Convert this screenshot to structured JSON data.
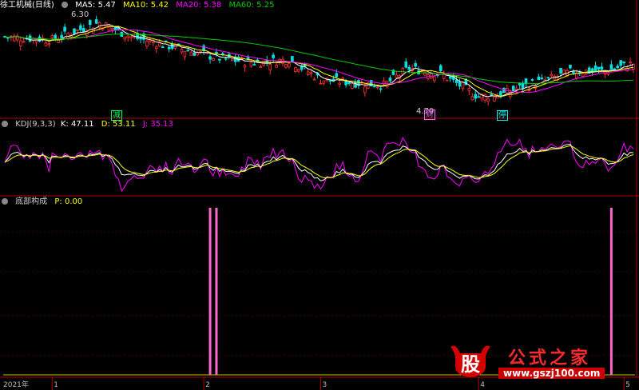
{
  "main_header": {
    "title": "徐工机械(日线)",
    "ma5_label": "MA5: 5.47",
    "ma10_label": "MA10: 5.42",
    "ma20_label": "MA20: 5.38",
    "ma60_label": "MA60: 5.25"
  },
  "kdj_header": {
    "name": "KDJ(9,3,3)",
    "k_label": "K: 47.11",
    "d_label": "D: 53.11",
    "j_label": "J: 35.13"
  },
  "bottom_header": {
    "name": "底部构成",
    "p_label": "P: 0.00"
  },
  "annotations": {
    "high_price": "6.30",
    "low_price": "4.70",
    "mark_jian": "减",
    "mark_cai": "财",
    "mark_ting": "停"
  },
  "time_axis": [
    "2021年",
    "1",
    "2",
    "3",
    "4",
    "5"
  ],
  "colors": {
    "up": "#ff3030",
    "down": "#00e0e0",
    "ma5": "#ffffff",
    "ma10": "#ffff00",
    "ma20": "#ff00ff",
    "ma60": "#00cc00",
    "k": "#ffffff",
    "d": "#ffff00",
    "j": "#ff00ff",
    "signal": "#ff66cc",
    "divider": "#b00000"
  },
  "watermark": {
    "logo_char": "股",
    "title": "公式之家",
    "url": "www.gszj100.com"
  },
  "chart_data": [
    {
      "type": "candlestick",
      "title": "徐工机械(日线)",
      "series": [
        {
          "name": "MA5",
          "last": 5.47
        },
        {
          "name": "MA10",
          "last": 5.42
        },
        {
          "name": "MA20",
          "last": 5.38
        },
        {
          "name": "MA60",
          "last": 5.25
        }
      ],
      "annotations": [
        {
          "label": "6.30",
          "kind": "high"
        },
        {
          "label": "4.70",
          "kind": "low"
        }
      ],
      "xlabels": [
        "2021年",
        "1",
        "2",
        "3",
        "4",
        "5"
      ]
    },
    {
      "type": "line",
      "title": "KDJ(9,3,3)",
      "series": [
        {
          "name": "K",
          "last": 47.11
        },
        {
          "name": "D",
          "last": 53.11
        },
        {
          "name": "J",
          "last": 35.13
        }
      ]
    },
    {
      "type": "bar",
      "title": "底部构成",
      "series": [
        {
          "name": "P",
          "last": 0.0
        }
      ],
      "signal_days": [
        65,
        67,
        192
      ]
    }
  ]
}
